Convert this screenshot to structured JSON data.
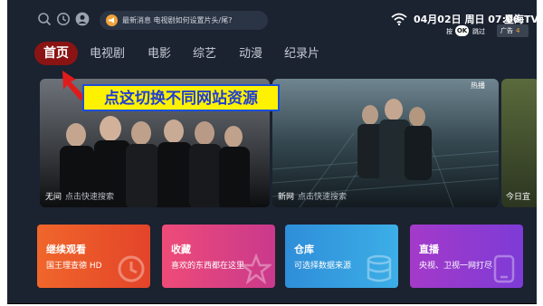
{
  "topbar": {
    "icons": [
      "search-icon",
      "history-icon",
      "user-icon"
    ],
    "news": {
      "label": "最新消息",
      "text": "电视剧如何设置片头/尾?"
    },
    "clock": "04月02日 周日 07:06",
    "brand": "星海TV",
    "skip": {
      "pre": "按",
      "key": "OK",
      "post": "跳过",
      "ad_label": "广告",
      "ad_count": "4"
    }
  },
  "nav": {
    "tabs": [
      "首页",
      "电视剧",
      "电影",
      "综艺",
      "动漫",
      "纪录片"
    ],
    "active": "首页"
  },
  "annotation": "点这切换不同网站资源",
  "posters": [
    {
      "title": "无间",
      "hint": "点击快速搜索"
    },
    {
      "title": "新网",
      "hint": "点击快速搜索",
      "badge": "热播"
    },
    {
      "title": "今日宜",
      "hint": ""
    }
  ],
  "cards": [
    {
      "title": "继续观看",
      "subtitle": "国王理查德 HD",
      "color_from": "#f0662b",
      "color_to": "#e3442a",
      "icon": "history-icon"
    },
    {
      "title": "收藏",
      "subtitle": "喜欢的东西都在这里",
      "color_from": "#ee4b78",
      "color_to": "#c9398c",
      "icon": "star-icon"
    },
    {
      "title": "仓库",
      "subtitle": "可选择数据来源",
      "color_from": "#2f8ed9",
      "color_to": "#3caee6",
      "icon": "database-icon"
    },
    {
      "title": "直播",
      "subtitle": "央视、卫视一网打尽",
      "color_from": "#a43ac9",
      "color_to": "#7d3bd6",
      "icon": "tv-icon"
    }
  ]
}
